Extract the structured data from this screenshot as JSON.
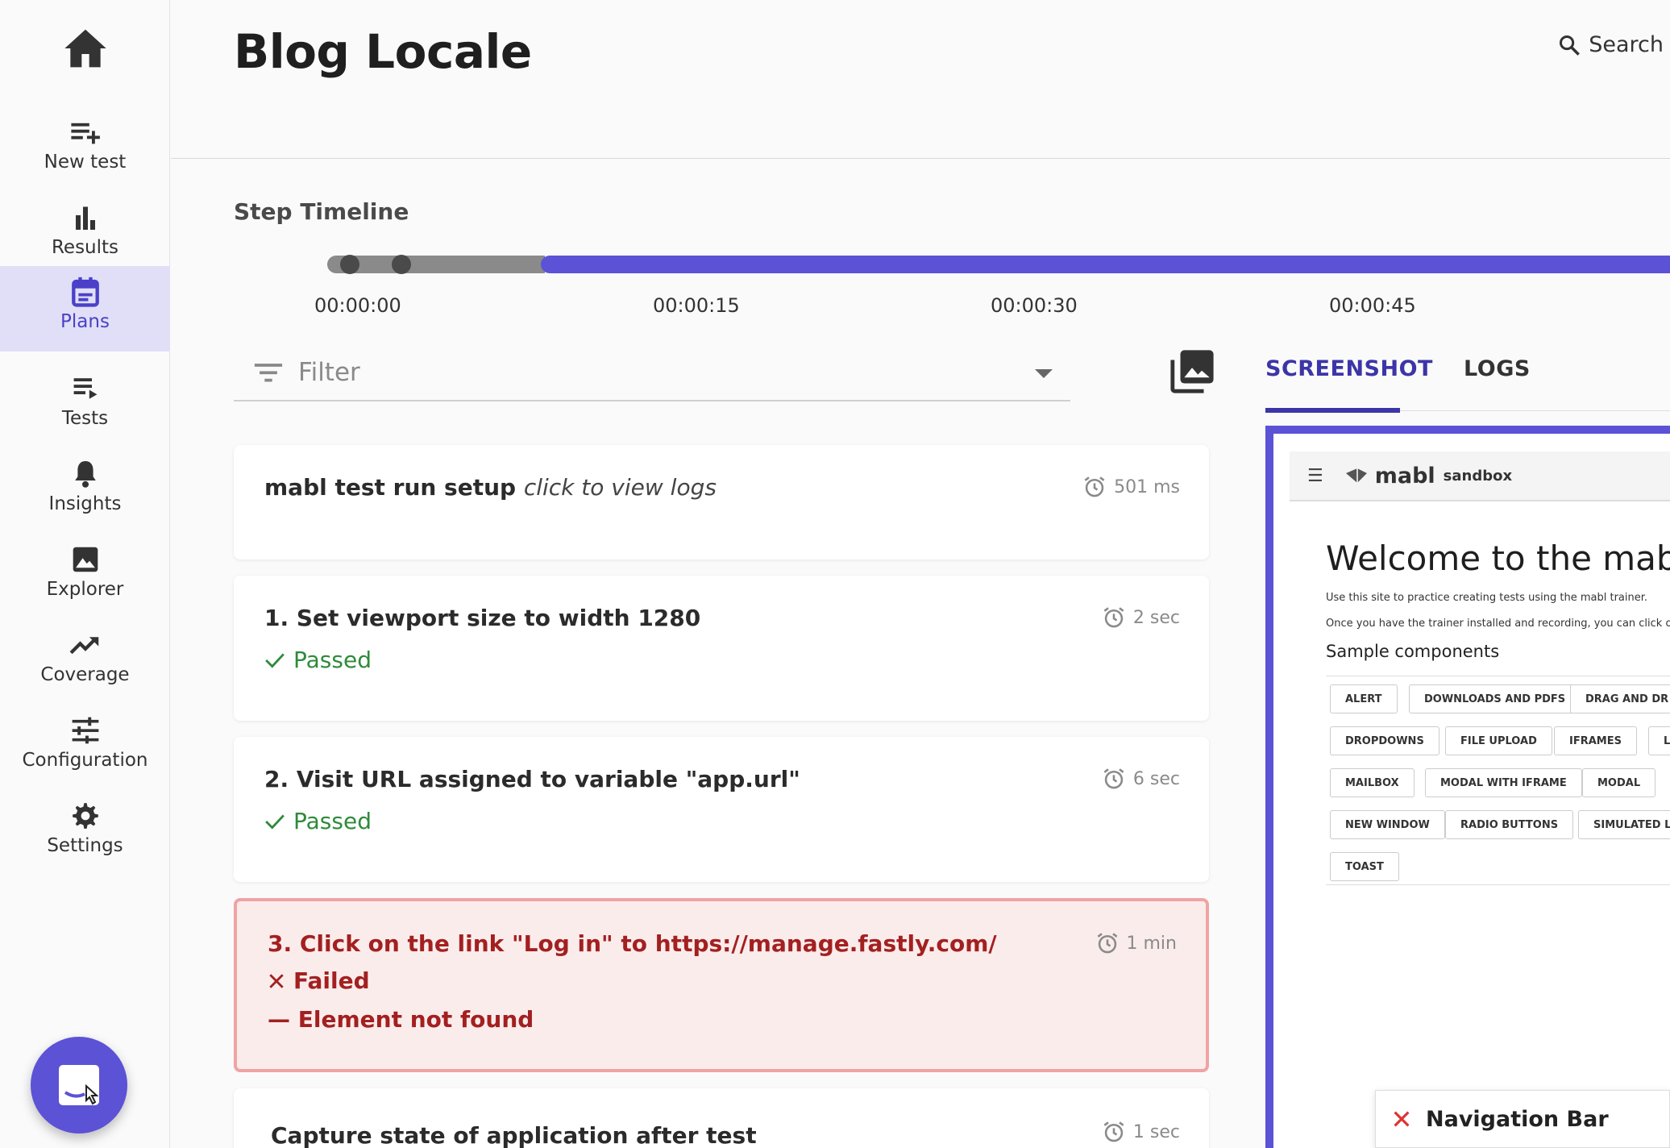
{
  "colors": {
    "accent": "#5b52d6",
    "passed": "#2e8b3a",
    "failed": "#a32020",
    "timeline_gray": "#8a8a8a"
  },
  "sidebar": {
    "items": [
      {
        "label": "New test",
        "icon": "playlist-add-icon"
      },
      {
        "label": "Results",
        "icon": "bar-chart-icon"
      },
      {
        "label": "Plans",
        "icon": "calendar-icon",
        "active": true
      },
      {
        "label": "Tests",
        "icon": "playlist-play-icon"
      },
      {
        "label": "Insights",
        "icon": "bell-icon"
      },
      {
        "label": "Explorer",
        "icon": "image-icon"
      },
      {
        "label": "Coverage",
        "icon": "trending-up-icon"
      },
      {
        "label": "Configuration",
        "icon": "sliders-icon"
      },
      {
        "label": "Settings",
        "icon": "gear-icon"
      }
    ]
  },
  "header": {
    "title": "Blog Locale",
    "search_label": "Search"
  },
  "timeline": {
    "title": "Step Timeline",
    "ticks": [
      "00:00:00",
      "00:00:15",
      "00:00:30",
      "00:00:45"
    ]
  },
  "filter": {
    "placeholder": "Filter"
  },
  "steps": [
    {
      "title": "mabl test run setup",
      "title_suffix": "click to view logs",
      "duration": "501 ms"
    },
    {
      "title": "1. Set viewport size to width 1280",
      "duration": "2 sec",
      "status": "Passed"
    },
    {
      "title": "2. Visit URL assigned to variable \"app.url\"",
      "duration": "6 sec",
      "status": "Passed"
    },
    {
      "title": "3. Click on the link \"Log in\" to https://manage.fastly.com/",
      "duration": "1 min",
      "status": "Failed",
      "status_detail": "— Element not found"
    },
    {
      "title": "Capture state of application after test",
      "duration": "1 sec"
    }
  ],
  "tabs": [
    {
      "label": "SCREENSHOT",
      "active": true
    },
    {
      "label": "LOGS",
      "active": false
    }
  ],
  "screenshot": {
    "logo": "mabl",
    "logo_sub": "sandbox",
    "heading": "Welcome to the mabl s",
    "para1": "Use this site to practice creating tests using the mabl trainer.",
    "para2": "Once you have the trainer installed and recording, you can click or",
    "subheading": "Sample components",
    "chips": [
      "ALERT",
      "DOWNLOADS AND PDFS",
      "DRAG AND DR",
      "DROPDOWNS",
      "FILE UPLOAD",
      "IFRAMES",
      "L",
      "MAILBOX",
      "MODAL WITH IFRAME",
      "MODAL",
      "NEW WINDOW",
      "RADIO BUTTONS",
      "SIMULATED L",
      "TOAST"
    ]
  },
  "toast": {
    "label": "Navigation Bar"
  }
}
